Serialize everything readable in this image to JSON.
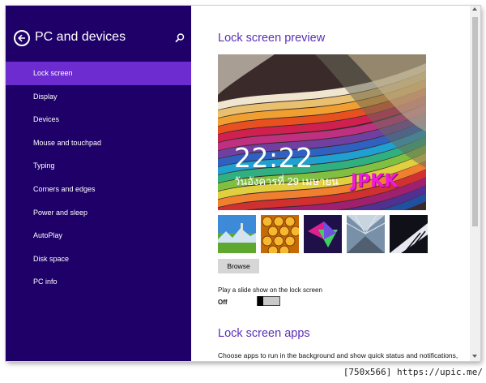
{
  "nav": {
    "title": "PC and devices",
    "items": [
      {
        "label": "Lock screen",
        "selected": true
      },
      {
        "label": "Display"
      },
      {
        "label": "Devices"
      },
      {
        "label": "Mouse and touchpad"
      },
      {
        "label": "Typing"
      },
      {
        "label": "Corners and edges"
      },
      {
        "label": "Power and sleep"
      },
      {
        "label": "AutoPlay"
      },
      {
        "label": "Disk space"
      },
      {
        "label": "PC info"
      }
    ]
  },
  "content": {
    "preview_heading": "Lock screen preview",
    "preview": {
      "time": "22:22",
      "date": "วันอังคารที่ 29 เมษายน",
      "overlay_text": "JPKK"
    },
    "thumbnails": [
      "landscape",
      "honeycomb",
      "geometric",
      "corridor",
      "piano-keys"
    ],
    "browse_label": "Browse",
    "slideshow_label": "Play a slide show on the lock screen",
    "slideshow_state": "Off",
    "apps_heading": "Lock screen apps",
    "apps_desc": "Choose apps to run in the background and show quick status and notifications,"
  },
  "footer": "[750x566] https://upic.me/",
  "colors": {
    "nav_bg": "#1f0068",
    "nav_selected": "#6c2ccf",
    "heading": "#5a2fb5",
    "overlay_text": "#ee1bd9"
  }
}
